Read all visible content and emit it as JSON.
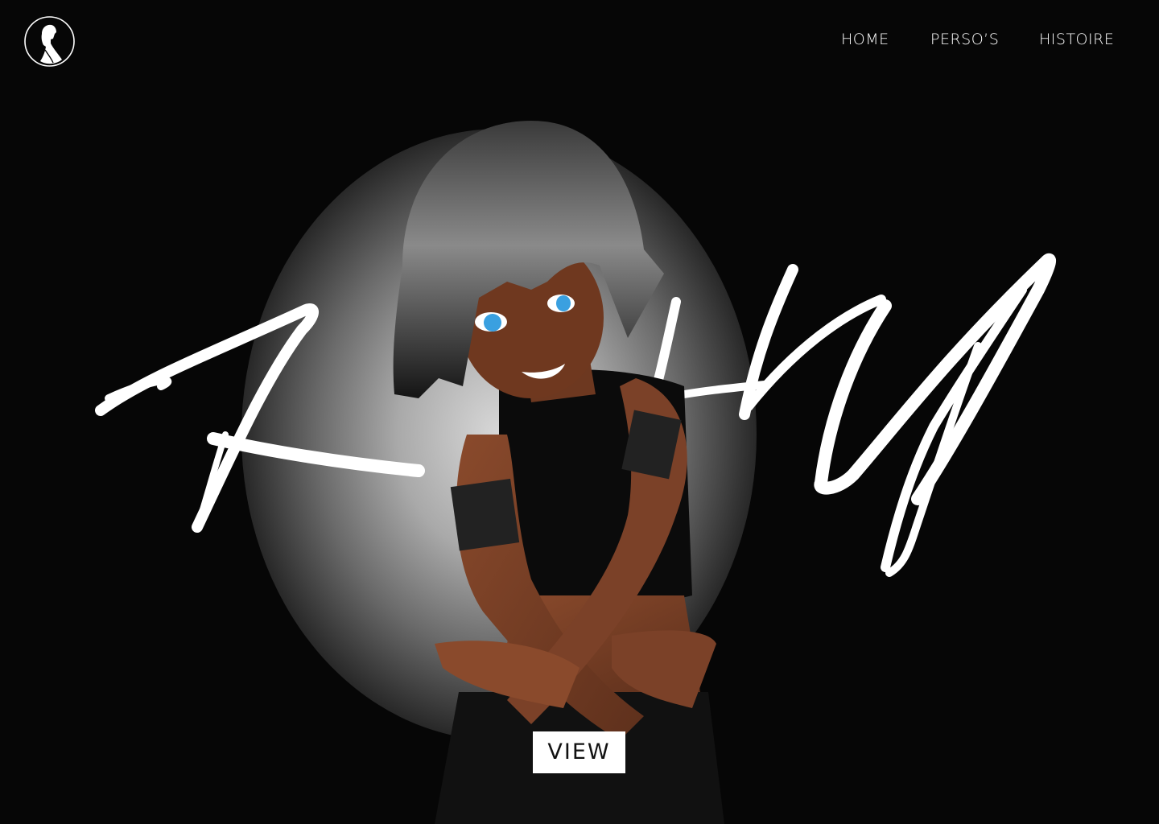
{
  "nav": {
    "items": [
      {
        "label": "HOME"
      },
      {
        "label": "PERSO’S"
      },
      {
        "label": "HISTOIRE"
      }
    ]
  },
  "hero": {
    "script_title": "KHN",
    "view_label": "VIEW"
  },
  "icons": {
    "logo": "woman-silhouette-logo-icon"
  },
  "colors": {
    "background": "#060606",
    "text": "#ffffff",
    "button_bg": "#ffffff",
    "button_text": "#111111",
    "skin": "#7a4127",
    "hair": "#1a1a1a",
    "eyes": "#3aa0e0"
  }
}
